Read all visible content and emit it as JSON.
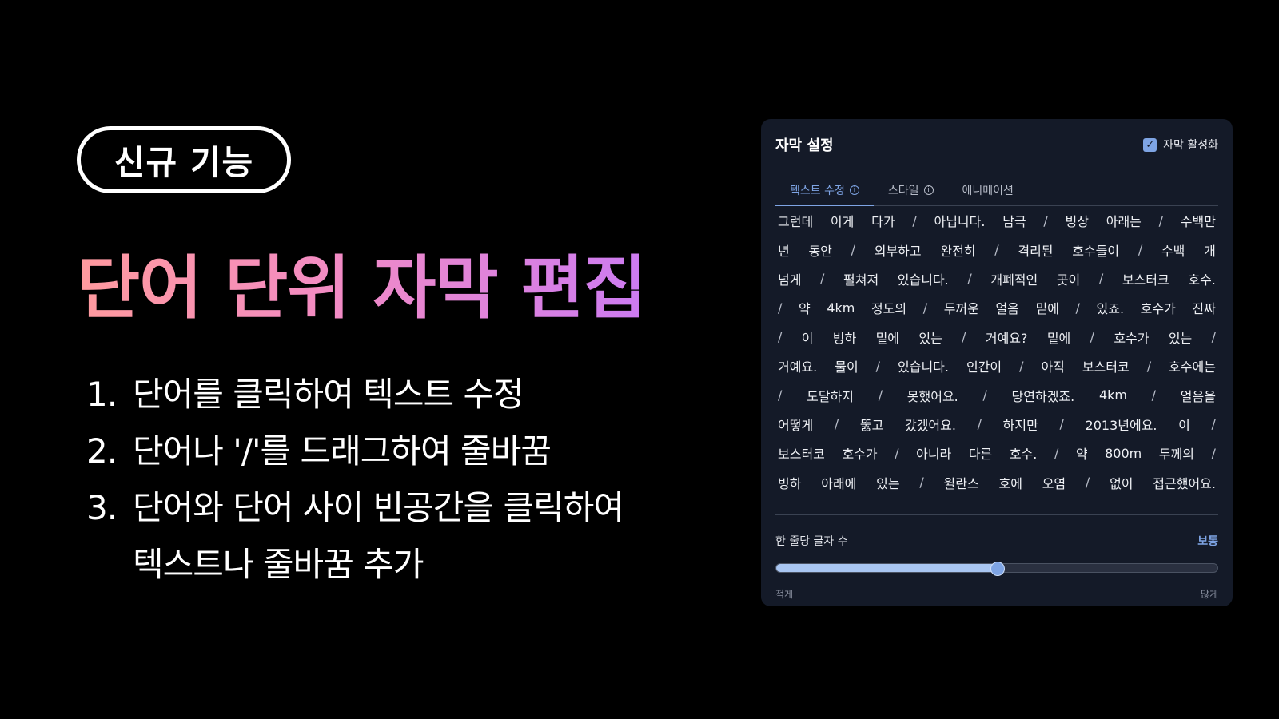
{
  "promo": {
    "badge": "신규 기능",
    "headline": "단어 단위 자막 편집",
    "steps": [
      {
        "num": "1.",
        "text": "단어를 클릭하여 텍스트 수정"
      },
      {
        "num": "2.",
        "text": "단어나 '/'를 드래그하여 줄바꿈"
      },
      {
        "num": "3.",
        "text": "단어와 단어 사이 빈공간을 클릭하여"
      }
    ],
    "step3_continuation": "텍스트나 줄바꿈 추가"
  },
  "panel": {
    "title": "자막 설정",
    "enable_label": "자막 활성화",
    "enable_checked": true,
    "tabs": [
      {
        "label": "텍스트 수정",
        "info": "i"
      },
      {
        "label": "스타일",
        "info": "i"
      },
      {
        "label": "애니메이션"
      }
    ],
    "active_tab": 0,
    "lines": [
      [
        "그런데",
        "이게",
        "다가",
        "/",
        "아닙니다.",
        "남극",
        "/",
        "빙상",
        "아래는",
        "/",
        "수백만"
      ],
      [
        "년",
        "동안",
        "/",
        "외부하고",
        "완전히",
        "/",
        "격리된",
        "호수들이",
        "/",
        "수백",
        "개"
      ],
      [
        "넘게",
        "/",
        "펼쳐져",
        "있습니다.",
        "/",
        "개폐적인",
        "곳이",
        "/",
        "보스터크",
        "호수."
      ],
      [
        "/",
        "약",
        "4km",
        "정도의",
        "/",
        "두꺼운",
        "얼음",
        "밑에",
        "/",
        "있죠.",
        "호수가",
        "진짜"
      ],
      [
        "/",
        "이",
        "빙하",
        "밑에",
        "있는",
        "/",
        "거예요?",
        "밑에",
        "/",
        "호수가",
        "있는",
        "/"
      ],
      [
        "거예요.",
        "물이",
        "/",
        "있습니다.",
        "인간이",
        "/",
        "아직",
        "보스터코",
        "/",
        "호수에는"
      ],
      [
        "/",
        "도달하지",
        "/",
        "못했어요.",
        "/",
        "당연하겠죠.",
        "4km",
        "/",
        "얼음을"
      ],
      [
        "어떻게",
        "/",
        "뚫고",
        "갔겠어요.",
        "/",
        "하지만",
        "/",
        "2013년에요.",
        "이",
        "/"
      ],
      [
        "보스터코",
        "호수가",
        "/",
        "아니라",
        "다른",
        "호수.",
        "/",
        "약",
        "800m",
        "두께의",
        "/"
      ],
      [
        "빙하",
        "아래에",
        "있는",
        "/",
        "윌란스",
        "호에",
        "오염",
        "/",
        "없이",
        "접근했어요."
      ]
    ],
    "slider": {
      "label": "한 줄당 글자 수",
      "value_label": "보통",
      "value": 0.5,
      "min_label": "적게",
      "max_label": "많게"
    },
    "colors": {
      "accent": "#7ea4e4",
      "panel_bg": "#141a28"
    }
  }
}
